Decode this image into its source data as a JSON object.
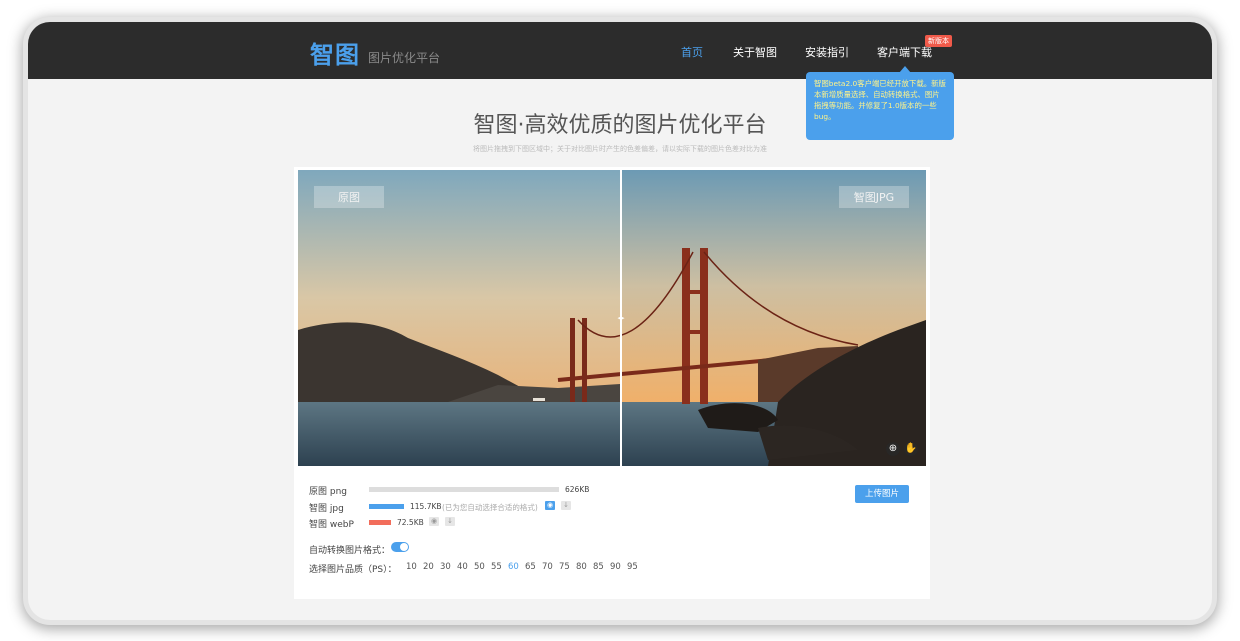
{
  "brand": {
    "name": "智图",
    "tagline": "图片优化平台"
  },
  "nav": {
    "items": [
      {
        "label": "首页",
        "active": true
      },
      {
        "label": "关于智图"
      },
      {
        "label": "安装指引"
      },
      {
        "label": "客户端下载"
      }
    ],
    "new_badge": "新版本",
    "tooltip": "智图beta2.0客户端已经开放下载。新版本新增质量选择、自动转换格式、图片拖拽等功能。并修复了1.0版本的一些bug。"
  },
  "hero": {
    "title": "智图·高效优质的图片优化平台",
    "subtitle": "将图片拖拽到下图区域中；关于对比图片时产生的色差偏差，请以实际下载的图片色差对比为准"
  },
  "compare": {
    "left_label": "原图",
    "right_label": "智图JPG"
  },
  "results": [
    {
      "label": "原图 png",
      "size": "626KB",
      "ratio": 1.0,
      "color": "#dddddd"
    },
    {
      "label": "智图 jpg",
      "size": "115.7KB",
      "ratio": 0.185,
      "color": "#4ba0ec",
      "hint": "(已为您自动选择合适的格式)"
    },
    {
      "label": "智图 webP",
      "size": "72.5KB",
      "ratio": 0.116,
      "color": "#f26d5b"
    }
  ],
  "upload_label": "上传图片",
  "auto_convert_label": "自动转换图片格式：",
  "auto_convert_on": true,
  "quality": {
    "label": "选择图片品质（PS）：",
    "options": [
      "10",
      "20",
      "30",
      "40",
      "50",
      "55",
      "60",
      "65",
      "70",
      "75",
      "80",
      "85",
      "90",
      "95"
    ],
    "selected": "60"
  },
  "icons": {
    "zoom": "zoom-in-icon",
    "hand": "hand-icon",
    "eye": "eye-icon",
    "download": "download-icon",
    "drag": "drag-handle-icon"
  }
}
